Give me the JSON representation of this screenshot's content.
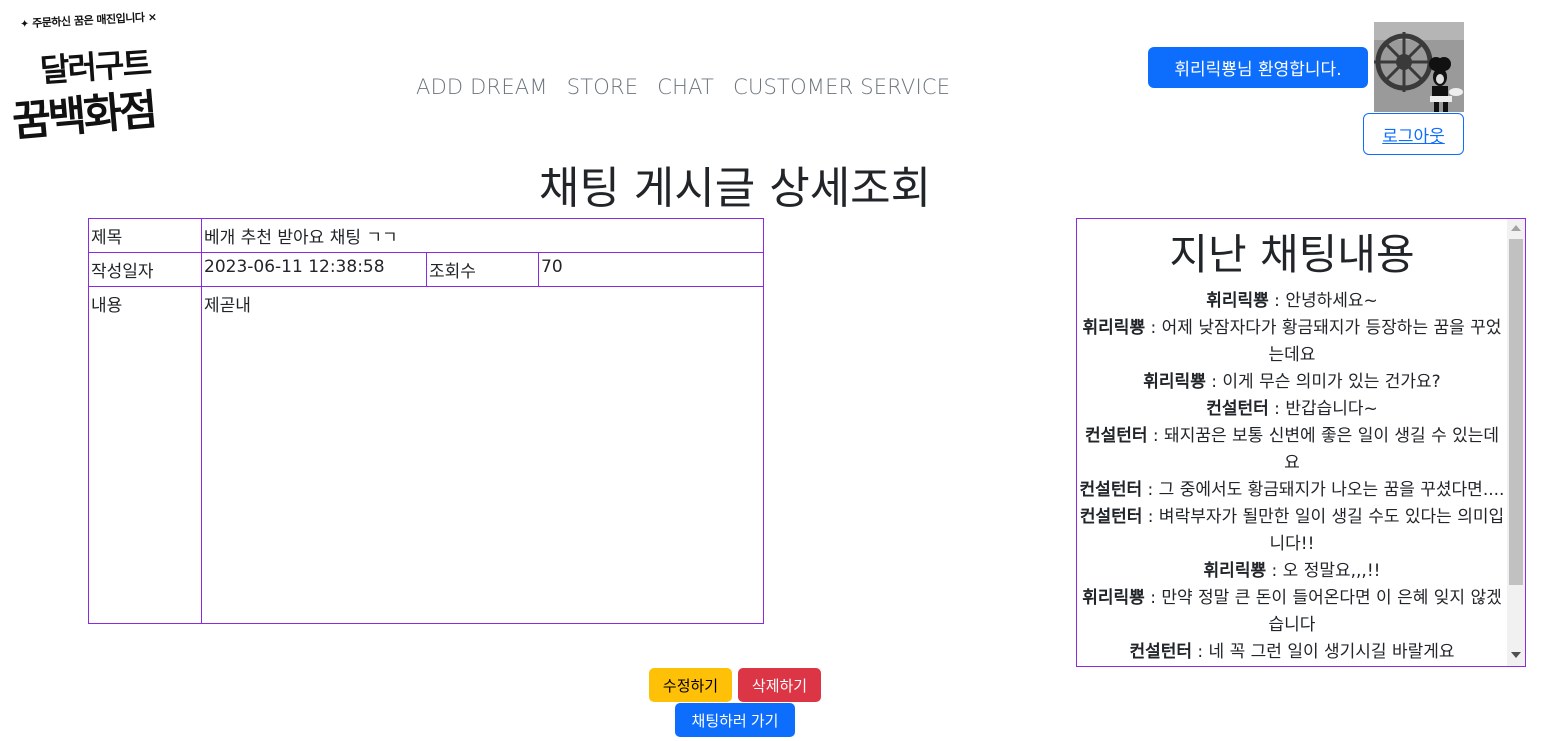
{
  "logo": {
    "tagline": "✦ 주문하신 꿈은 매진입니다 ×",
    "line1": "달러구트",
    "line2": "꿈백화점"
  },
  "nav": [
    {
      "label": "ADD DREAM"
    },
    {
      "label": "STORE"
    },
    {
      "label": "CHAT"
    },
    {
      "label": "CUSTOMER SERVICE"
    }
  ],
  "user": {
    "welcome": "휘리릭뿅님 환영합니다.",
    "logout": "로그아웃",
    "avatar_icon": "steamboat-mouse-avatar"
  },
  "page": {
    "title": "채팅 게시글 상세조회"
  },
  "detail": {
    "title_label": "제목",
    "title_value": "베개 추천 받아요 채팅 ㄱㄱ",
    "date_label": "작성일자",
    "date_value": "2023-06-11 12:38:58",
    "views_label": "조회수",
    "views_value": "70",
    "content_label": "내용",
    "content_value": "제곧내"
  },
  "history": {
    "title": "지난 채팅내용",
    "messages": [
      {
        "sender": "휘리릭뿅",
        "text": " : 안녕하세요~"
      },
      {
        "sender": "휘리릭뿅",
        "text": " : 어제 낮잠자다가 황금돼지가 등장하는 꿈을 꾸었는데요"
      },
      {
        "sender": "휘리릭뿅",
        "text": " : 이게 무슨 의미가 있는 건가요?"
      },
      {
        "sender": "컨설턴터",
        "text": " : 반갑습니다~"
      },
      {
        "sender": "컨설턴터",
        "text": " : 돼지꿈은 보통 신변에 좋은 일이 생길 수 있는데요"
      },
      {
        "sender": "컨설턴터",
        "text": " : 그 중에서도 황금돼지가 나오는 꿈을 꾸셨다면...."
      },
      {
        "sender": "컨설턴터",
        "text": " : 벼락부자가 될만한 일이 생길 수도 있다는 의미입니다!!"
      },
      {
        "sender": "휘리릭뿅",
        "text": " : 오 정말요,,,!!"
      },
      {
        "sender": "휘리릭뿅",
        "text": " : 만약 정말 큰 돈이 들어온다면 이 은혜 잊지 않겠습니다"
      },
      {
        "sender": "컨설턴터",
        "text": " : 네 꼭 그런 일이 생기시길 바랄게요"
      }
    ]
  },
  "buttons": {
    "edit": "수정하기",
    "delete": "삭제하기",
    "go_chat": "채팅하러 가기"
  },
  "colors": {
    "primary": "#0d6efd",
    "warning": "#ffc107",
    "danger": "#dc3545",
    "table_border": "#8a2be2"
  }
}
